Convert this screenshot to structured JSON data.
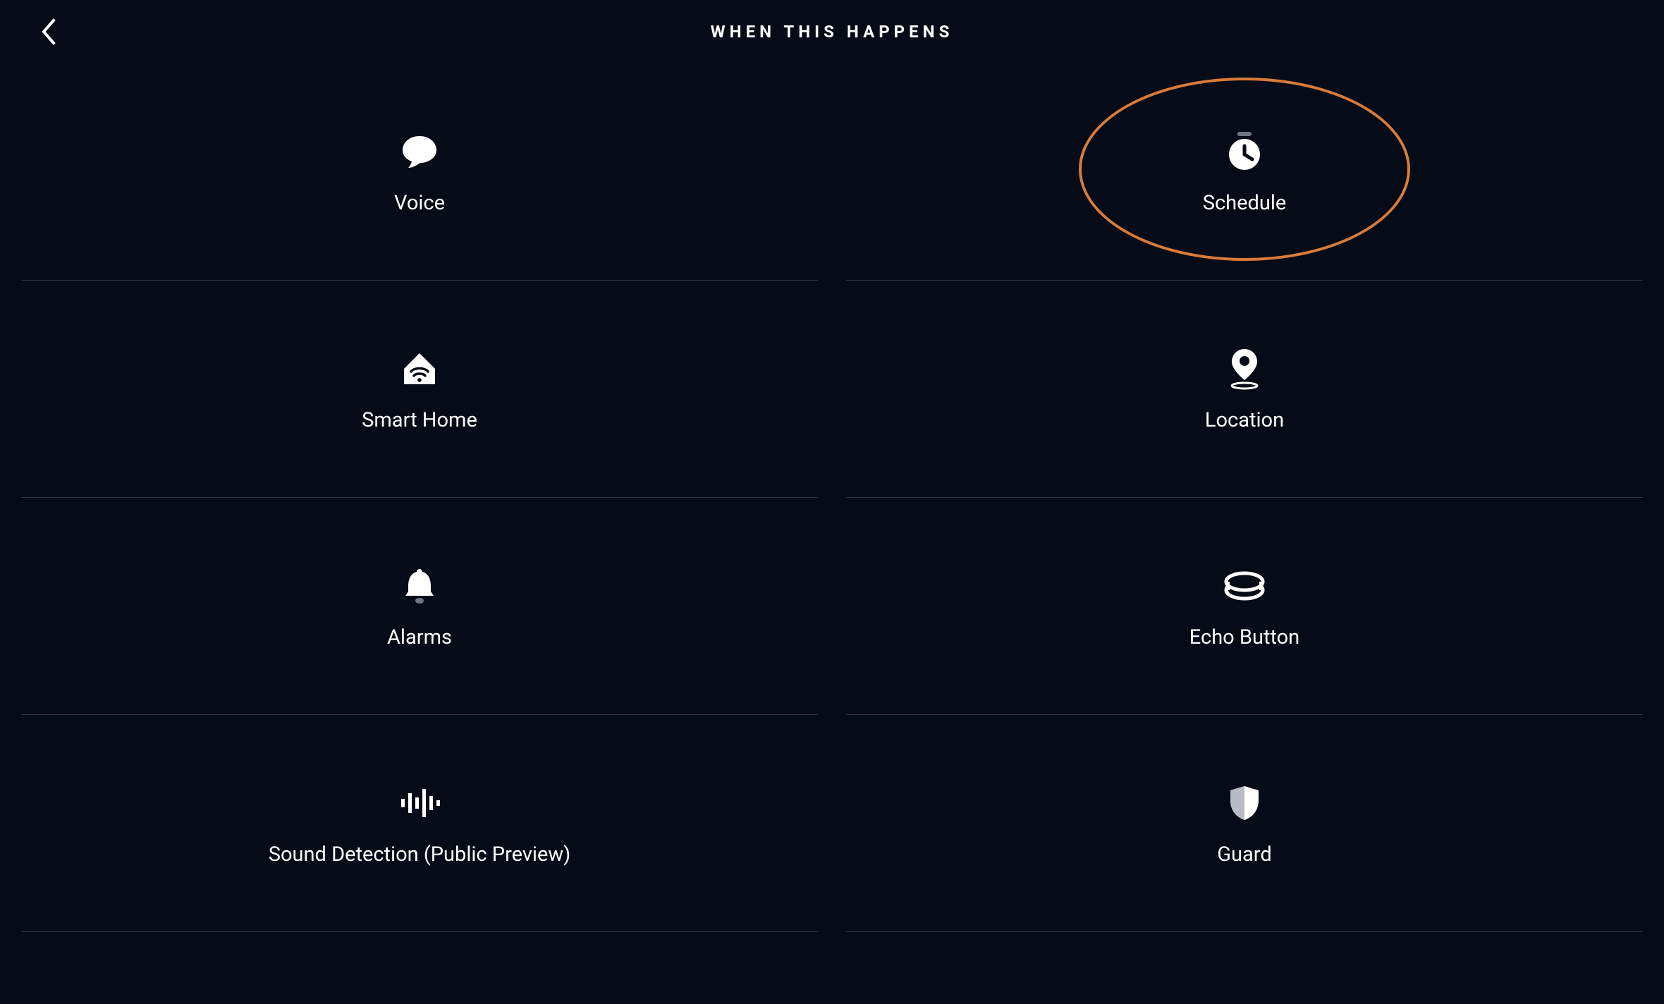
{
  "header": {
    "title": "WHEN THIS HAPPENS"
  },
  "options": {
    "voice": {
      "label": "Voice"
    },
    "schedule": {
      "label": "Schedule"
    },
    "smart_home": {
      "label": "Smart Home"
    },
    "location": {
      "label": "Location"
    },
    "alarms": {
      "label": "Alarms"
    },
    "echo_button": {
      "label": "Echo Button"
    },
    "sound_detection": {
      "label": "Sound Detection (Public Preview)"
    },
    "guard": {
      "label": "Guard"
    }
  },
  "annotation": {
    "highlight_target": "schedule",
    "color": "#d97b3a"
  }
}
